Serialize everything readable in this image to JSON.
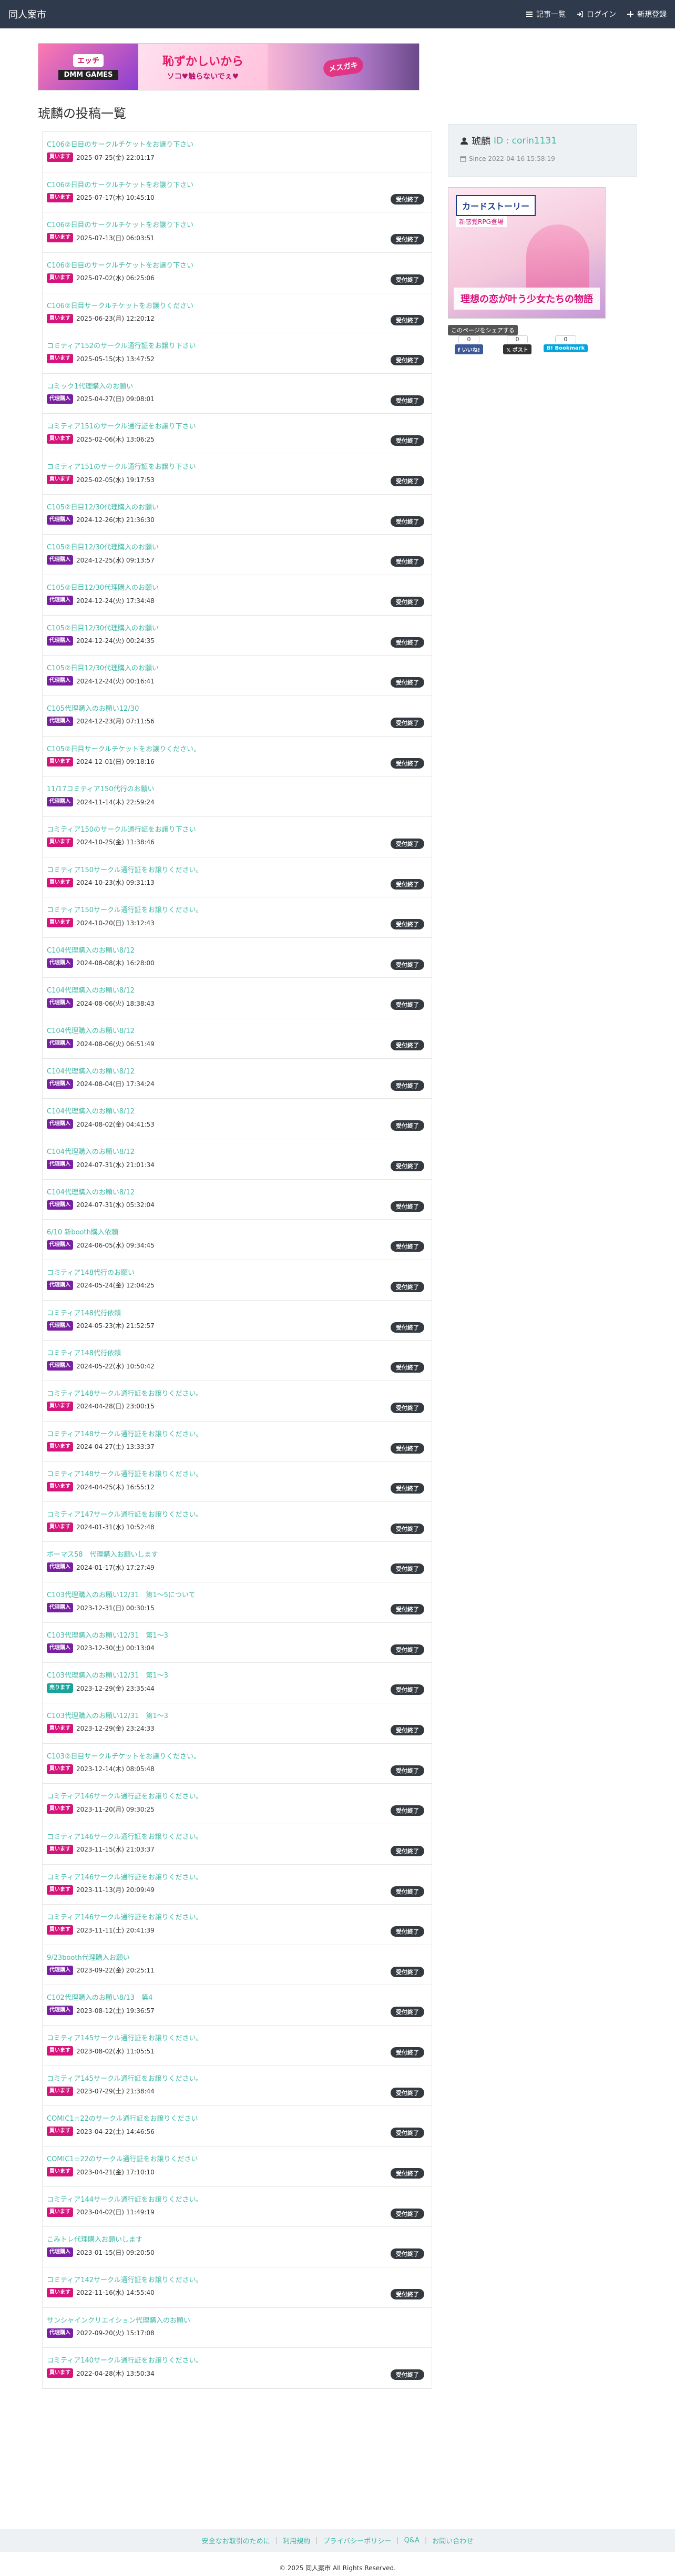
{
  "nav": {
    "brand": "同人案市",
    "links": [
      {
        "label": "記事一覧",
        "icon": "list-icon"
      },
      {
        "label": "ログイン",
        "icon": "login-icon"
      },
      {
        "label": "新規登録",
        "icon": "plus-icon"
      }
    ]
  },
  "banner": {
    "left_line1": "エッチ",
    "left_line2": "DMM GAMES",
    "mid_line1": "恥ずかしいから",
    "mid_line2": "ソコ♥触らないでぇ♥",
    "right_text": "メスガキ"
  },
  "page": {
    "title": "琥麟の投稿一覧"
  },
  "profile": {
    "name": "琥麟",
    "id_label": "ID : corin1131",
    "since": "Since 2022-04-16 15:58:19"
  },
  "side_ad": {
    "title": "カードストーリー",
    "subtitle": "新感覚RPG登場",
    "caption": "理想の恋が叶う少女たちの物語"
  },
  "share": {
    "label": "このページをシェアする",
    "items": [
      {
        "count": "0",
        "label": "いいね!",
        "icon": "facebook-icon"
      },
      {
        "count": "0",
        "label": "ポスト",
        "icon": "x-icon"
      },
      {
        "count": "0",
        "label": "Bookmark",
        "icon": "hatena-icon"
      }
    ]
  },
  "posts": [
    {
      "title": "C106②日目のサークルチケットをお譲り下さい",
      "badge": "買います",
      "type": "pink",
      "date": "2025-07-25(金) 22:01:17",
      "closed": ""
    },
    {
      "title": "C106②日目のサークルチケットをお譲り下さい",
      "badge": "買います",
      "type": "pink",
      "date": "2025-07-17(木) 10:45:10",
      "closed": "受付終了"
    },
    {
      "title": "C106②日目のサークルチケットをお譲り下さい",
      "badge": "買います",
      "type": "pink",
      "date": "2025-07-13(日) 06:03:51",
      "closed": "受付終了"
    },
    {
      "title": "C106②日目のサークルチケットをお譲り下さい",
      "badge": "買います",
      "type": "pink",
      "date": "2025-07-02(水) 06:25:06",
      "closed": "受付終了"
    },
    {
      "title": "C106②日目サークルチケットをお譲りください",
      "badge": "買います",
      "type": "pink",
      "date": "2025-06-23(月) 12:20:12",
      "closed": "受付終了"
    },
    {
      "title": "コミティア152のサークル通行証をお譲り下さい",
      "badge": "買います",
      "type": "pink",
      "date": "2025-05-15(木) 13:47:52",
      "closed": "受付終了"
    },
    {
      "title": "コミック1代理購入のお願い",
      "badge": "代理購入",
      "type": "purple",
      "date": "2025-04-27(日) 09:08:01",
      "closed": "受付終了"
    },
    {
      "title": "コミティア151のサークル通行証をお譲り下さい",
      "badge": "買います",
      "type": "pink",
      "date": "2025-02-06(木) 13:06:25",
      "closed": "受付終了"
    },
    {
      "title": "コミティア151のサークル通行証をお譲り下さい",
      "badge": "買います",
      "type": "pink",
      "date": "2025-02-05(水) 19:17:53",
      "closed": "受付終了"
    },
    {
      "title": "C105②日目12/30代理購入のお願い",
      "badge": "代理購入",
      "type": "purple",
      "date": "2024-12-26(木) 21:36:30",
      "closed": "受付終了"
    },
    {
      "title": "C105②日目12/30代理購入のお願い",
      "badge": "代理購入",
      "type": "purple",
      "date": "2024-12-25(水) 09:13:57",
      "closed": "受付終了"
    },
    {
      "title": "C105②日目12/30代理購入のお願い",
      "badge": "代理購入",
      "type": "purple",
      "date": "2024-12-24(火) 17:34:48",
      "closed": "受付終了"
    },
    {
      "title": "C105②日目12/30代理購入のお願い",
      "badge": "代理購入",
      "type": "purple",
      "date": "2024-12-24(火) 00:24:35",
      "closed": "受付終了"
    },
    {
      "title": "C105②日目12/30代理購入のお願い",
      "badge": "代理購入",
      "type": "purple",
      "date": "2024-12-24(火) 00:16:41",
      "closed": "受付終了"
    },
    {
      "title": "C105代理購入のお願い12/30",
      "badge": "代理購入",
      "type": "purple",
      "date": "2024-12-23(月) 07:11:56",
      "closed": "受付終了"
    },
    {
      "title": "C105②日目サークルチケットをお譲りください。",
      "badge": "買います",
      "type": "pink",
      "date": "2024-12-01(日) 09:18:16",
      "closed": "受付終了"
    },
    {
      "title": "11/17コミティア150代行のお願い",
      "badge": "代理購入",
      "type": "purple",
      "date": "2024-11-14(木) 22:59:24",
      "closed": ""
    },
    {
      "title": "コミティア150のサークル通行証をお譲り下さい",
      "badge": "買います",
      "type": "pink",
      "date": "2024-10-25(金) 11:38:46",
      "closed": "受付終了"
    },
    {
      "title": "コミティア150サークル通行証をお譲りください。",
      "badge": "買います",
      "type": "pink",
      "date": "2024-10-23(水) 09:31:13",
      "closed": "受付終了"
    },
    {
      "title": "コミティア150サークル通行証をお譲りください。",
      "badge": "買います",
      "type": "pink",
      "date": "2024-10-20(日) 13:12:43",
      "closed": "受付終了"
    },
    {
      "title": "C104代理購入のお願い8/12",
      "badge": "代理購入",
      "type": "purple",
      "date": "2024-08-08(木) 16:28:00",
      "closed": "受付終了"
    },
    {
      "title": "C104代理購入のお願い8/12",
      "badge": "代理購入",
      "type": "purple",
      "date": "2024-08-06(火) 18:38:43",
      "closed": "受付終了"
    },
    {
      "title": "C104代理購入のお願い8/12",
      "badge": "代理購入",
      "type": "purple",
      "date": "2024-08-06(火) 06:51:49",
      "closed": "受付終了"
    },
    {
      "title": "C104代理購入のお願い8/12",
      "badge": "代理購入",
      "type": "purple",
      "date": "2024-08-04(日) 17:34:24",
      "closed": "受付終了"
    },
    {
      "title": "C104代理購入のお願い8/12",
      "badge": "代理購入",
      "type": "purple",
      "date": "2024-08-02(金) 04:41:53",
      "closed": "受付終了"
    },
    {
      "title": "C104代理購入のお願い8/12",
      "badge": "代理購入",
      "type": "purple",
      "date": "2024-07-31(水) 21:01:34",
      "closed": "受付終了"
    },
    {
      "title": "C104代理購入のお願い8/12",
      "badge": "代理購入",
      "type": "purple",
      "date": "2024-07-31(水) 05:32:04",
      "closed": "受付終了"
    },
    {
      "title": "6/10 新booth購入依頼",
      "badge": "代理購入",
      "type": "purple",
      "date": "2024-06-05(水) 09:34:45",
      "closed": "受付終了"
    },
    {
      "title": "コミティア148代行のお願い",
      "badge": "代理購入",
      "type": "purple",
      "date": "2024-05-24(金) 12:04:25",
      "closed": "受付終了"
    },
    {
      "title": "コミティア148代行依頼",
      "badge": "代理購入",
      "type": "purple",
      "date": "2024-05-23(木) 21:52:57",
      "closed": "受付終了"
    },
    {
      "title": "コミティア148代行依頼",
      "badge": "代理購入",
      "type": "purple",
      "date": "2024-05-22(水) 10:50:42",
      "closed": "受付終了"
    },
    {
      "title": "コミティア148サークル通行証をお譲りください。",
      "badge": "買います",
      "type": "pink",
      "date": "2024-04-28(日) 23:00:15",
      "closed": "受付終了"
    },
    {
      "title": "コミティア148サークル通行証をお譲りください。",
      "badge": "買います",
      "type": "pink",
      "date": "2024-04-27(土) 13:33:37",
      "closed": "受付終了"
    },
    {
      "title": "コミティア148サークル通行証をお譲りください。",
      "badge": "買います",
      "type": "pink",
      "date": "2024-04-25(木) 16:55:12",
      "closed": "受付終了"
    },
    {
      "title": "コミティア147サークル通行証をお譲りください。",
      "badge": "買います",
      "type": "pink",
      "date": "2024-01-31(水) 10:52:48",
      "closed": "受付終了"
    },
    {
      "title": "ボーマス58　代理購入お願いします",
      "badge": "代理購入",
      "type": "purple",
      "date": "2024-01-17(水) 17:27:49",
      "closed": "受付終了"
    },
    {
      "title": "C103代理購入のお願い12/31　第1〜5について",
      "badge": "代理購入",
      "type": "purple",
      "date": "2023-12-31(日) 00:30:15",
      "closed": "受付終了"
    },
    {
      "title": "C103代理購入のお願い12/31　第1〜3",
      "badge": "代理購入",
      "type": "purple",
      "date": "2023-12-30(土) 00:13:04",
      "closed": "受付終了"
    },
    {
      "title": "C103代理購入のお願い12/31　第1〜3",
      "badge": "売ります",
      "type": "teal",
      "date": "2023-12-29(金) 23:35:44",
      "closed": "受付終了"
    },
    {
      "title": "C103代理購入のお願い12/31　第1〜3",
      "badge": "買います",
      "type": "pink",
      "date": "2023-12-29(金) 23:24:33",
      "closed": "受付終了"
    },
    {
      "title": "C103②日目サークルチケットをお譲りください。",
      "badge": "買います",
      "type": "pink",
      "date": "2023-12-14(木) 08:05:48",
      "closed": "受付終了"
    },
    {
      "title": "コミティア146サークル通行証をお譲りください。",
      "badge": "買います",
      "type": "pink",
      "date": "2023-11-20(月) 09:30:25",
      "closed": "受付終了"
    },
    {
      "title": "コミティア146サークル通行証をお譲りください。",
      "badge": "買います",
      "type": "pink",
      "date": "2023-11-15(水) 21:03:37",
      "closed": "受付終了"
    },
    {
      "title": "コミティア146サークル通行証をお譲りください。",
      "badge": "買います",
      "type": "pink",
      "date": "2023-11-13(月) 20:09:49",
      "closed": "受付終了"
    },
    {
      "title": "コミティア146サークル通行証をお譲りください。",
      "badge": "買います",
      "type": "pink",
      "date": "2023-11-11(土) 20:41:39",
      "closed": "受付終了"
    },
    {
      "title": "9/23booth代理購入お願い",
      "badge": "代理購入",
      "type": "purple",
      "date": "2023-09-22(金) 20:25:11",
      "closed": "受付終了"
    },
    {
      "title": "C102代理購入のお願い8/13　第4",
      "badge": "代理購入",
      "type": "purple",
      "date": "2023-08-12(土) 19:36:57",
      "closed": "受付終了"
    },
    {
      "title": "コミティア145サークル通行証をお譲りください。",
      "badge": "買います",
      "type": "pink",
      "date": "2023-08-02(水) 11:05:51",
      "closed": "受付終了"
    },
    {
      "title": "コミティア145サークル通行証をお譲りください。",
      "badge": "買います",
      "type": "pink",
      "date": "2023-07-29(土) 21:38:44",
      "closed": "受付終了"
    },
    {
      "title": "COMIC1☆22のサークル通行証をお譲りください",
      "badge": "買います",
      "type": "pink",
      "date": "2023-04-22(土) 14:46:56",
      "closed": "受付終了"
    },
    {
      "title": "COMIC1☆22のサークル通行証をお譲りください",
      "badge": "買います",
      "type": "pink",
      "date": "2023-04-21(金) 17:10:10",
      "closed": "受付終了"
    },
    {
      "title": "コミティア144サークル通行証をお譲りください。",
      "badge": "買います",
      "type": "pink",
      "date": "2023-04-02(日) 11:49:19",
      "closed": "受付終了"
    },
    {
      "title": "こみトレ代理購入お願いします",
      "badge": "代理購入",
      "type": "purple",
      "date": "2023-01-15(日) 09:20:50",
      "closed": "受付終了"
    },
    {
      "title": "コミティア142サークル通行証をお譲りください。",
      "badge": "買います",
      "type": "pink",
      "date": "2022-11-16(水) 14:55:40",
      "closed": "受付終了"
    },
    {
      "title": "サンシャインクリエイション代理購入のお願い",
      "badge": "代理購入",
      "type": "purple",
      "date": "2022-09-20(火) 15:17:08",
      "closed": ""
    },
    {
      "title": "コミティア140サークル通行証をお譲りください。",
      "badge": "買います",
      "type": "pink",
      "date": "2022-04-28(木) 13:50:34",
      "closed": "受付終了"
    }
  ],
  "footer": {
    "links": [
      "安全なお取引のために",
      "利用規約",
      "プライバシーポリシー",
      "Q&A",
      "お問い合わせ"
    ],
    "copyright": "© 2025 同人案市 All Rights Reserved."
  }
}
